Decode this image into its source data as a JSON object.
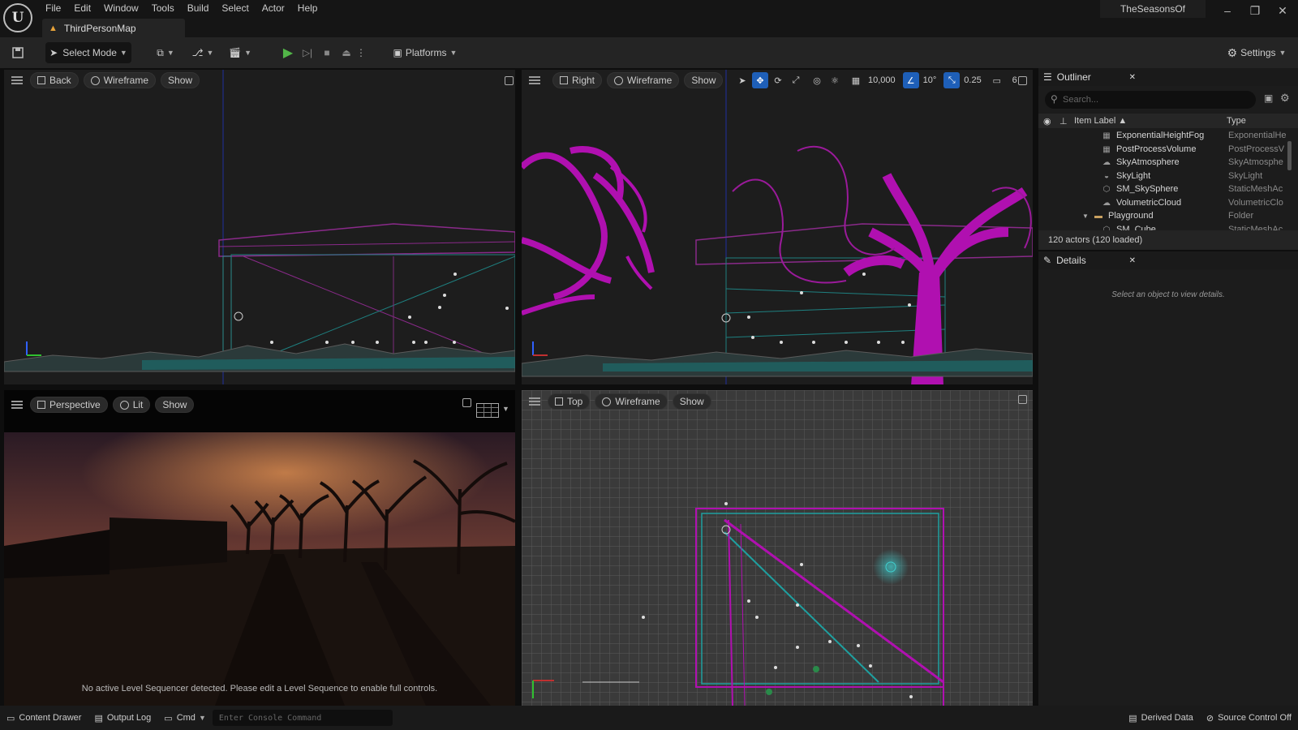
{
  "menu": [
    "File",
    "Edit",
    "Window",
    "Tools",
    "Build",
    "Select",
    "Actor",
    "Help"
  ],
  "document_tab": "ThirdPersonMap",
  "project_name": "TheSeasonsOf",
  "toolbar": {
    "select_mode": "Select Mode",
    "platforms": "Platforms",
    "settings": "Settings"
  },
  "viewports": {
    "back": {
      "view": "Back",
      "mode": "Wireframe",
      "show": "Show"
    },
    "right": {
      "view": "Right",
      "mode": "Wireframe",
      "show": "Show",
      "snap": {
        "grid": "10,000",
        "rotation": "10°",
        "scale": "0.25",
        "camera_speed": "6"
      }
    },
    "perspective": {
      "view": "Perspective",
      "mode": "Lit",
      "show": "Show",
      "sequencer_message": "No active Level Sequencer detected. Please edit a Level Sequence to enable full controls."
    },
    "top": {
      "view": "Top",
      "mode": "Wireframe",
      "show": "Show"
    }
  },
  "outliner": {
    "title": "Outliner",
    "search_placeholder": "Search...",
    "col_label": "Item Label",
    "col_type": "Type",
    "rows": [
      {
        "label": "ExponentialHeightFog",
        "type": "ExponentialHe"
      },
      {
        "label": "PostProcessVolume",
        "type": "PostProcessV"
      },
      {
        "label": "SkyAtmosphere",
        "type": "SkyAtmosphe"
      },
      {
        "label": "SkyLight",
        "type": "SkyLight"
      },
      {
        "label": "SM_SkySphere",
        "type": "StaticMeshAc"
      },
      {
        "label": "VolumetricCloud",
        "type": "VolumetricClo"
      },
      {
        "label": "Playground",
        "type": "Folder"
      },
      {
        "label": "SM_Cube",
        "type": "StaticMeshAc"
      }
    ],
    "footer": "120 actors (120 loaded)"
  },
  "details": {
    "title": "Details",
    "empty": "Select an object to view details."
  },
  "statusbar": {
    "content_drawer": "Content Drawer",
    "output_log": "Output Log",
    "cmd": "Cmd",
    "console_placeholder": "Enter Console Command",
    "derived_data": "Derived Data",
    "source_control": "Source Control Off"
  }
}
